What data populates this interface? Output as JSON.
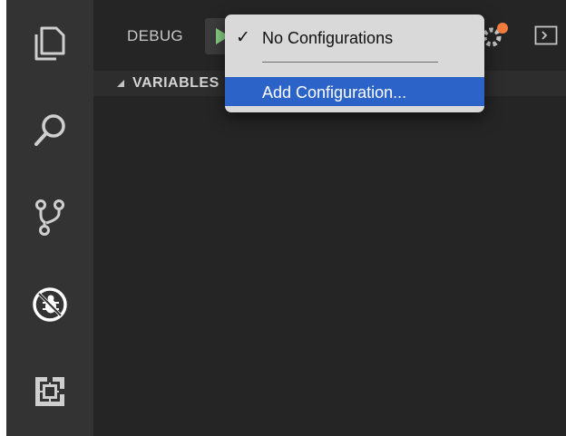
{
  "debug_header": {
    "title": "DEBUG",
    "accent_play": "#89d185"
  },
  "variables_section": {
    "title": "VARIABLES"
  },
  "config_dropdown": {
    "items": [
      {
        "label": "No Configurations",
        "checked": true
      },
      {
        "label": "Add Configuration...",
        "highlighted": true
      }
    ],
    "highlight_color": "#2b63c9"
  },
  "activity_bar": {
    "items": [
      {
        "name": "explorer-icon"
      },
      {
        "name": "search-icon"
      },
      {
        "name": "source-control-icon"
      },
      {
        "name": "debug-icon",
        "active": true
      },
      {
        "name": "extensions-icon"
      }
    ]
  },
  "badges": {
    "gear_notification_color": "#f47c3c"
  },
  "symbols": {
    "check": "✓"
  }
}
